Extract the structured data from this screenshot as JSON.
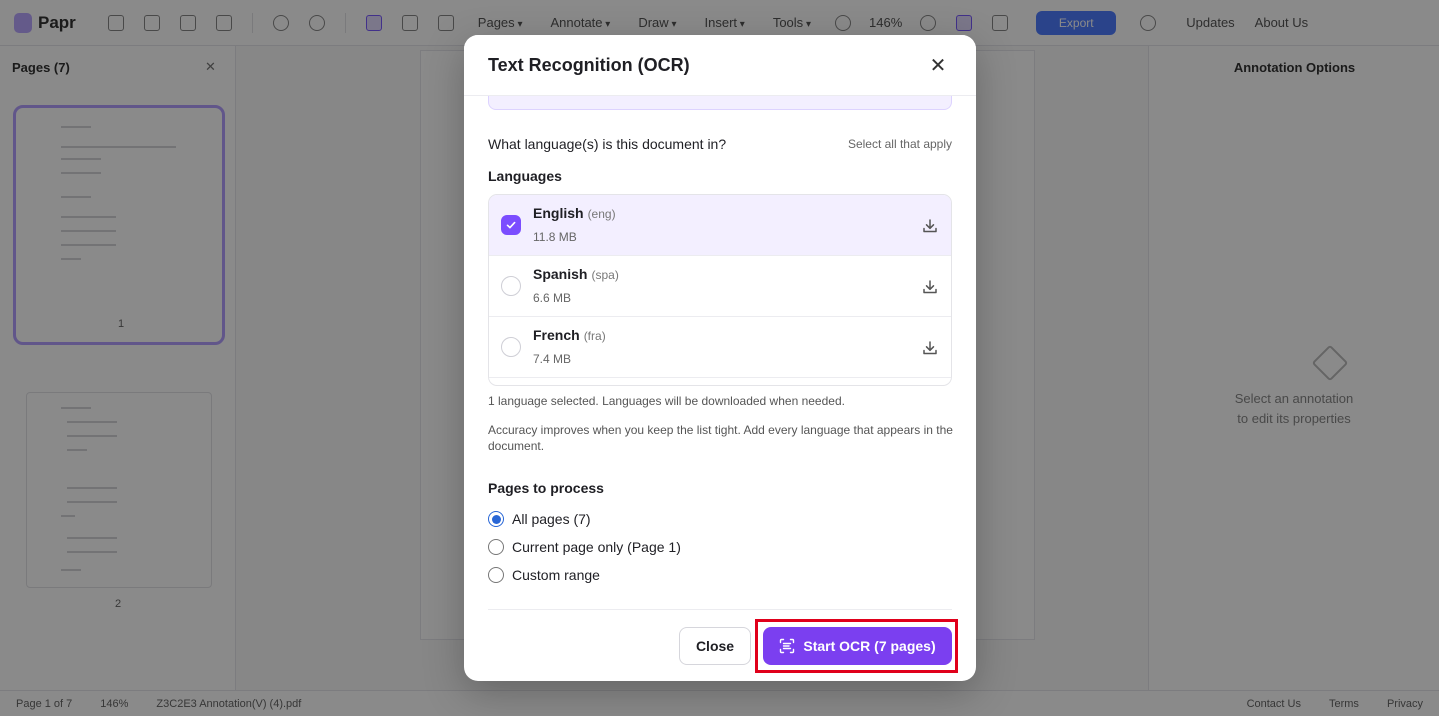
{
  "app": {
    "logo": "Papr",
    "menus": [
      "Pages",
      "Annotate",
      "Draw",
      "Insert",
      "Tools"
    ],
    "zoom": "146%",
    "export_label": "Export",
    "links": [
      "Updates",
      "About Us"
    ],
    "left_panel": {
      "title": "Pages (7)",
      "page_numbers": [
        "1",
        "2"
      ]
    },
    "right_panel": {
      "title": "Annotation Options",
      "empty_text": "Select an annotation to edit its properties"
    },
    "status": {
      "page": "Page 1 of 7",
      "zoom": "146%",
      "file": "Z3C2E3 Annotation(V) (4).pdf",
      "right": [
        "Contact Us",
        "Terms",
        "Privacy"
      ]
    }
  },
  "modal": {
    "title": "Text Recognition (OCR)",
    "close_icon": "close-icon",
    "question": "What language(s) is this document in?",
    "hint": "Select all that apply",
    "languages_label": "Languages",
    "languages": [
      {
        "name": "English",
        "code": "(eng)",
        "size": "11.8 MB",
        "checked": true
      },
      {
        "name": "Spanish",
        "code": "(spa)",
        "size": "6.6 MB",
        "checked": false
      },
      {
        "name": "French",
        "code": "(fra)",
        "size": "7.4 MB",
        "checked": false
      }
    ],
    "selection_note": "1 language selected. Languages will be downloaded when needed.",
    "accuracy_note": "Accuracy improves when you keep the list tight. Add every language that appears in the document.",
    "pages_label": "Pages to process",
    "page_options": [
      {
        "label": "All pages (7)",
        "selected": true
      },
      {
        "label": "Current page only (Page 1)",
        "selected": false
      },
      {
        "label": "Custom range",
        "selected": false
      }
    ],
    "close_button": "Close",
    "start_button": "Start OCR (7 pages)"
  },
  "colors": {
    "accent": "#7b3ff0",
    "highlight": "#e0001b",
    "radio": "#2866d6"
  }
}
